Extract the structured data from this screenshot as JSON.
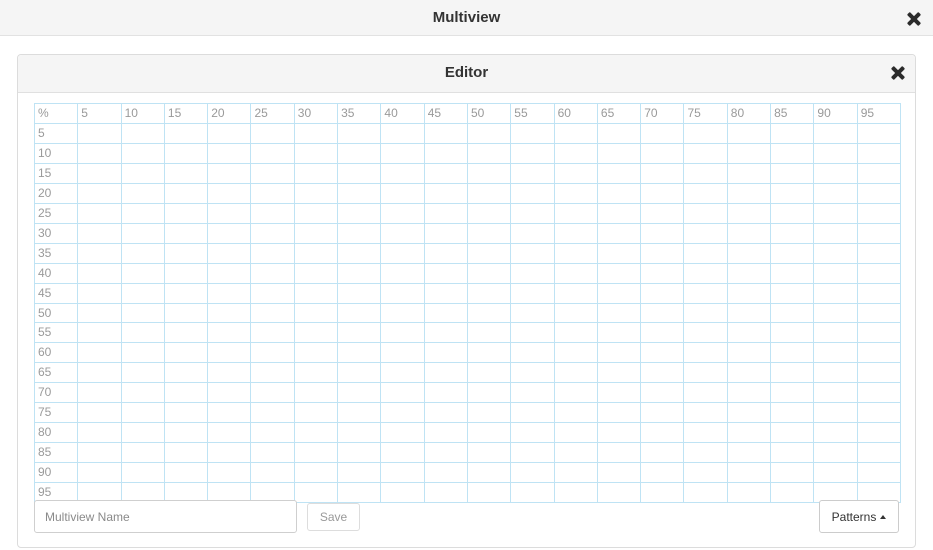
{
  "window": {
    "title": "Multiview",
    "close_icon": "close-icon"
  },
  "editor": {
    "title": "Editor",
    "close_icon": "close-icon",
    "grid": {
      "corner_label": "%",
      "column_labels": [
        "5",
        "10",
        "15",
        "20",
        "25",
        "30",
        "35",
        "40",
        "45",
        "50",
        "55",
        "60",
        "65",
        "70",
        "75",
        "80",
        "85",
        "90",
        "95"
      ],
      "row_labels": [
        "5",
        "10",
        "15",
        "20",
        "25",
        "30",
        "35",
        "40",
        "45",
        "50",
        "55",
        "60",
        "65",
        "70",
        "75",
        "80",
        "85",
        "90",
        "95"
      ]
    },
    "name_input": {
      "placeholder": "Multiview Name",
      "value": ""
    },
    "save_label": "Save",
    "patterns_label": "Patterns",
    "patterns_icon": "caret-up-icon"
  },
  "colors": {
    "grid_line": "#bfe3f4",
    "header_bg": "#f5f5f5",
    "label_text": "#9a9a9a"
  }
}
